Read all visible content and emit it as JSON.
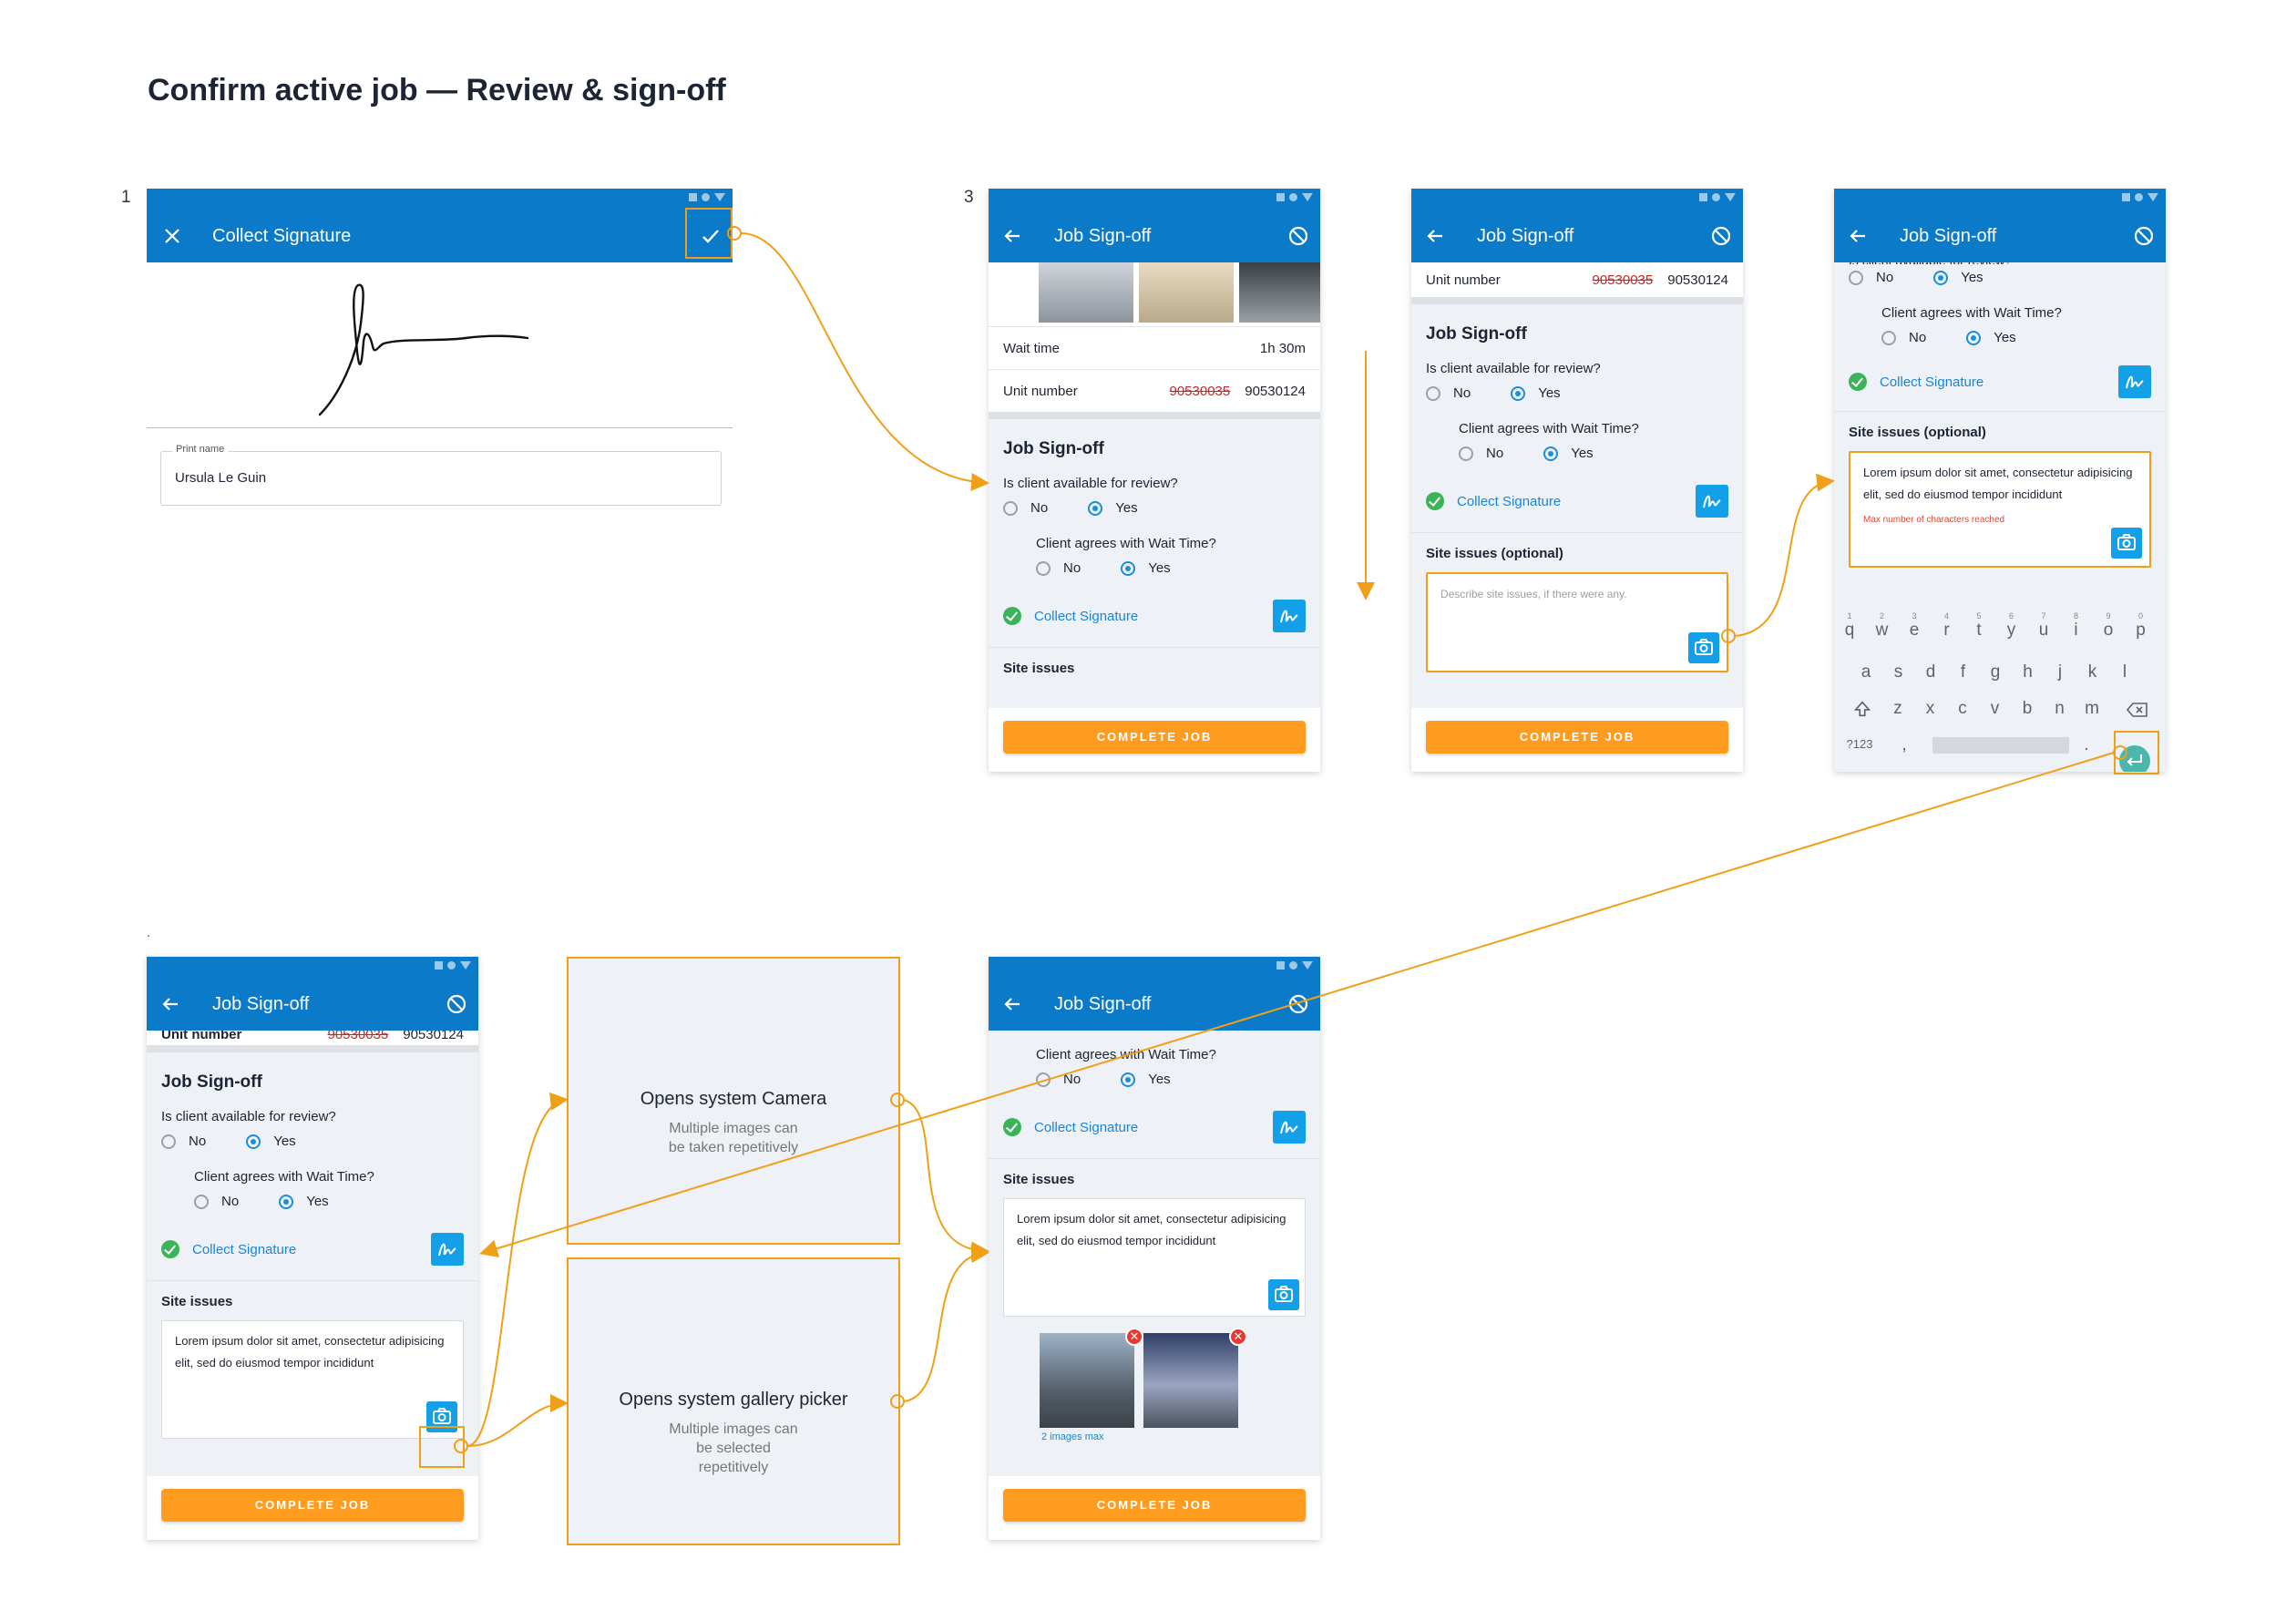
{
  "page": {
    "title": "Confirm active job — Review & sign-off",
    "step_1": "1",
    "step_3": "3",
    "step_dot": "."
  },
  "colors": {
    "accent": "#0a7ac9",
    "cta": "#ff9c1f",
    "flow": "#f0a018",
    "link": "#1786d8",
    "error": "#c62828",
    "success": "#3bb35a"
  },
  "icons": [
    "close-icon",
    "check-icon",
    "back-arrow-icon",
    "cancel-icon",
    "signature-icon",
    "camera-icon",
    "checkmark-circle-icon",
    "remove-image-icon",
    "enter-key-icon",
    "shift-icon",
    "backspace-icon"
  ],
  "screen1": {
    "title": "Collect Signature",
    "print_label": "Print name",
    "print_value": "Ursula Le Guin"
  },
  "common": {
    "title": "Job Sign-off",
    "wait_label": "Wait time",
    "wait_value": "1h 30m",
    "unit_label": "Unit number",
    "unit_old": "90530035",
    "unit_new": "90530124",
    "section": "Job Sign-off",
    "q1": "Is client available for review?",
    "q1_cut": "Is client available for review?",
    "no": "No",
    "yes": "Yes",
    "q2": "Client agrees with Wait Time?",
    "collect_sig": "Collect Signature",
    "site_issues": "Site issues",
    "site_issues_opt": "Site issues (optional)",
    "placeholder": "Describe site issues, if there were any.",
    "lorem": "Lorem ipsum dolor sit amet, consectetur adipisicing elit, sed do eiusmod tempor incididunt",
    "max_chars": "Max number of characters reached",
    "complete": "COMPLETE JOB",
    "images_max": "2 images max"
  },
  "keyboard": {
    "row1": [
      "q",
      "w",
      "e",
      "r",
      "t",
      "y",
      "u",
      "i",
      "o",
      "p"
    ],
    "row1_nums": [
      "1",
      "2",
      "3",
      "4",
      "5",
      "6",
      "7",
      "8",
      "9",
      "0"
    ],
    "row2": [
      "a",
      "s",
      "d",
      "f",
      "g",
      "h",
      "j",
      "k",
      "l"
    ],
    "row3": [
      "z",
      "x",
      "c",
      "v",
      "b",
      "n",
      "m"
    ],
    "sym": "?123",
    "comma": ",",
    "period": "."
  },
  "flow": {
    "camera_title": "Opens system Camera",
    "camera_sub": "Multiple images can be taken repetitively",
    "gallery_title": "Opens system gallery picker",
    "gallery_sub": "Multiple images can be selected repetitively"
  }
}
